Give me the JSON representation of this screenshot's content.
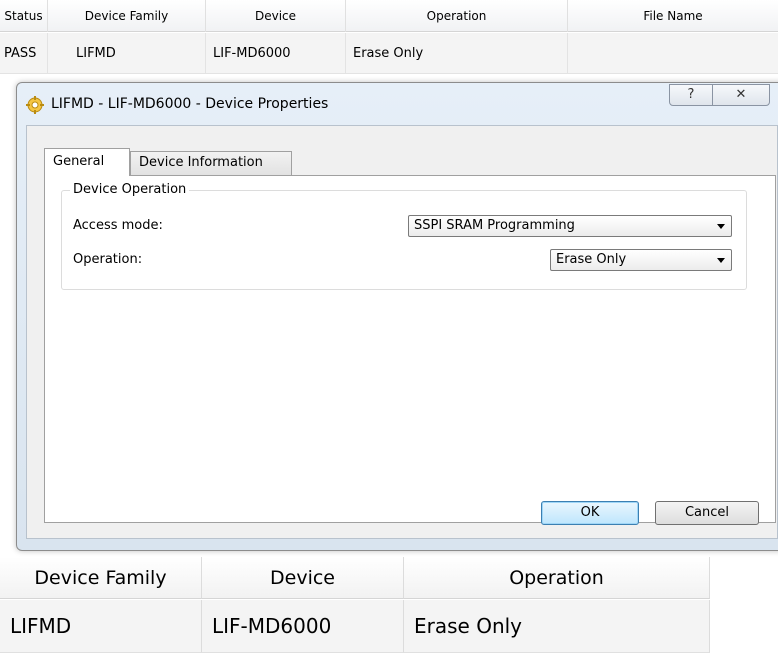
{
  "top_table": {
    "headers": [
      "Status",
      "Device Family",
      "Device",
      "Operation",
      "File Name"
    ],
    "row": [
      "PASS",
      "LIFMD",
      "LIF-MD6000",
      "Erase Only",
      ""
    ]
  },
  "dialog": {
    "title": "LIFMD - LIF-MD6000 - Device Properties",
    "help_label": "?",
    "close_label": "✕",
    "tabs": {
      "general": "General",
      "device_information": "Device Information"
    },
    "group_title": "Device Operation",
    "access_mode_label": "Access mode:",
    "access_mode_value": "SSPI SRAM Programming",
    "operation_label": "Operation:",
    "operation_value": "Erase Only",
    "ok_label": "OK",
    "cancel_label": "Cancel"
  },
  "bottom_table": {
    "headers": [
      "Device Family",
      "Device",
      "Operation"
    ],
    "row": [
      "LIFMD",
      "LIF-MD6000",
      "Erase Only"
    ]
  },
  "icons": {
    "title_icon": "device-properties-icon"
  }
}
